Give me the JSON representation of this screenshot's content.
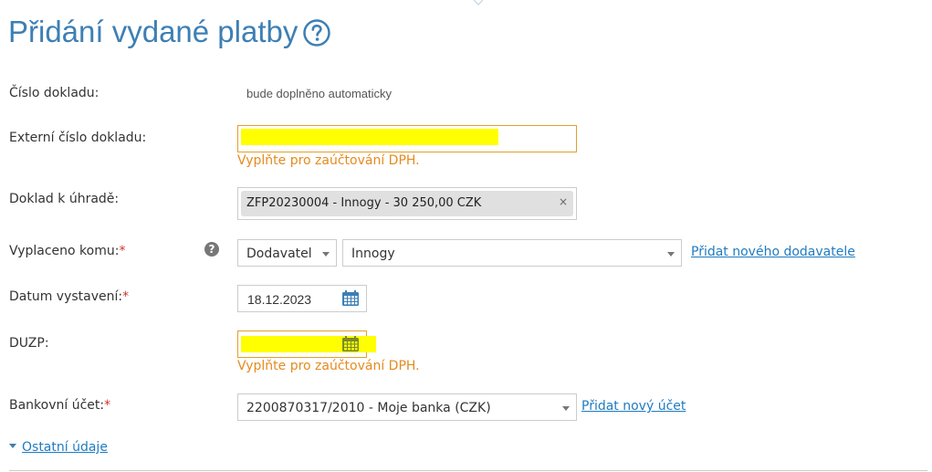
{
  "title": "Přidání vydané platby",
  "help_icon": "question-circle-icon",
  "fields": {
    "doc_number": {
      "label": "Číslo dokladu:",
      "value": "bude doplněno automaticky"
    },
    "external_doc_number": {
      "label": "Externí číslo dokladu:",
      "value": "",
      "hint": "Vyplňte pro zaúčtování DPH."
    },
    "doc_to_pay": {
      "label": "Doklad k úhradě:",
      "chip": "ZFP20230004 - Innogy - 30 250,00 CZK",
      "remove": "×"
    },
    "paid_to": {
      "label": "Vyplaceno komu:",
      "required_mark": "*",
      "type_value": "Dodavatel",
      "party_value": "Innogy",
      "add_link": "Přidat nového dodavatele",
      "help": "?"
    },
    "issue_date": {
      "label": "Datum vystavení:",
      "required_mark": "*",
      "value": "18.12.2023"
    },
    "duzp": {
      "label": "DUZP:",
      "value": "",
      "hint": "Vyplňte pro zaúčtování DPH."
    },
    "bank_account": {
      "label": "Bankovní účet:",
      "required_mark": "*",
      "value": "2200870317/2010 - Moje banka (CZK)",
      "add_link": "Přidat nový účet"
    }
  },
  "other_info_toggle": "Ostatní údaje",
  "colors": {
    "title": "#3d7fb4",
    "link": "#1f7bc1",
    "warning": "#e68a1e",
    "warning_border": "#e0a02a",
    "required": "#d0312d",
    "highlight": "#ffff00",
    "calendar": "#3d7fb4"
  }
}
